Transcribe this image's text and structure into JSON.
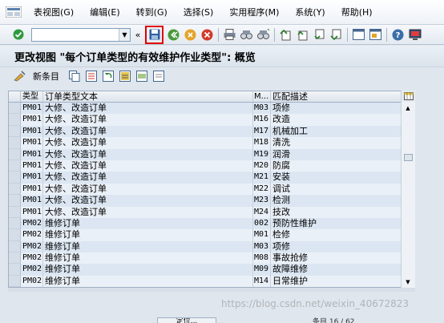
{
  "menubar": {
    "items": [
      "表视图(G)",
      "编辑(E)",
      "转到(G)",
      "选择(S)",
      "实用程序(M)",
      "系统(Y)",
      "帮助(H)"
    ]
  },
  "toolbar": {
    "command_field": {
      "value": "",
      "placeholder": ""
    },
    "highlighted_button": "save-icon"
  },
  "title": "更改视图 \"每个订单类型的有效维护作业类型\": 概览",
  "app_toolbar": {
    "new_entries_label": "新条目"
  },
  "table": {
    "headers": [
      "类型",
      "订单类型文本",
      "M...",
      "匹配描述"
    ],
    "rows": [
      [
        "PM01",
        "大修、改造订单",
        "M03",
        "项修"
      ],
      [
        "PM01",
        "大修、改造订单",
        "M16",
        "改造"
      ],
      [
        "PM01",
        "大修、改造订单",
        "M17",
        "机械加工"
      ],
      [
        "PM01",
        "大修、改造订单",
        "M18",
        "清洗"
      ],
      [
        "PM01",
        "大修、改造订单",
        "M19",
        "润滑"
      ],
      [
        "PM01",
        "大修、改造订单",
        "M20",
        "防腐"
      ],
      [
        "PM01",
        "大修、改造订单",
        "M21",
        "安装"
      ],
      [
        "PM01",
        "大修、改造订单",
        "M22",
        "调试"
      ],
      [
        "PM01",
        "大修、改造订单",
        "M23",
        "检测"
      ],
      [
        "PM01",
        "大修、改造订单",
        "M24",
        "技改"
      ],
      [
        "PM02",
        "维修订单",
        "002",
        "预防性维护"
      ],
      [
        "PM02",
        "维修订单",
        "M01",
        "检修"
      ],
      [
        "PM02",
        "维修订单",
        "M03",
        "项修"
      ],
      [
        "PM02",
        "维修订单",
        "M08",
        "事故抢修"
      ],
      [
        "PM02",
        "维修订单",
        "M09",
        "故障维修"
      ],
      [
        "PM02",
        "维修订单",
        "M14",
        "日常维护"
      ]
    ]
  },
  "footer": {
    "position_button": "定位...",
    "entry_count": "条目 16 / 62"
  },
  "watermark": "https://blog.csdn.net/weixin_40672823",
  "colors": {
    "highlight": "#e00000",
    "row_even": "#eaf0f7",
    "row_odd": "#dbe6f2"
  }
}
